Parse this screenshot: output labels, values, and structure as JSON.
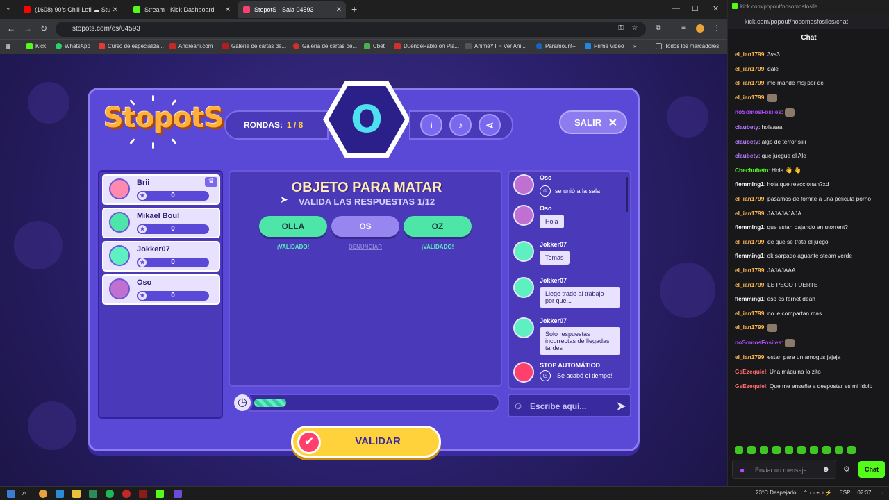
{
  "browser": {
    "tabs": [
      {
        "title": "(1608) 90's Chill Lofi ☁ Stu",
        "icon_color": "#ff0000"
      },
      {
        "title": "Stream - Kick Dashboard",
        "icon_color": "#53fc18"
      },
      {
        "title": "StopotS - Sala 04593",
        "icon_color": "#ff3f6c",
        "active": true
      }
    ],
    "url": "stopots.com/es/04593",
    "bookmarks": [
      {
        "label": "Kick",
        "color": "#53fc18"
      },
      {
        "label": "WhatsApp",
        "color": "#25d366"
      },
      {
        "label": "Curso de especializa...",
        "color": "#e53935"
      },
      {
        "label": "Andreani.com",
        "color": "#c62828"
      },
      {
        "label": "Galería de cartas de...",
        "color": "#b71c1c"
      },
      {
        "label": "Galería de cartas de...",
        "color": "#d32f2f"
      },
      {
        "label": "Cbet",
        "color": "#4caf50"
      },
      {
        "label": "DuendePablo on Pla...",
        "color": "#d32f2f"
      },
      {
        "label": "AnimeYT ~ Ver Ani...",
        "color": "#555555"
      },
      {
        "label": "Paramount+",
        "color": "#1565c0"
      },
      {
        "label": "Prime Video",
        "color": "#1e88e5"
      },
      {
        "label": "Todos los marcadores",
        "color": "#888888"
      }
    ]
  },
  "game": {
    "logo": "StopotS",
    "rounds_label": "RONDAS:",
    "rounds_value": "1 / 8",
    "letter": "O",
    "exit_label": "SALIR",
    "category": "OBJETO PARA MATAR",
    "validate_info": "VALIDA LAS RESPUESTAS 1/12",
    "answers": [
      {
        "text": "OLLA",
        "status": "¡VALIDADO!",
        "state": "ok"
      },
      {
        "text": "OS",
        "status": "DENUNCIAR",
        "state": "pending"
      },
      {
        "text": "OZ",
        "status": "¡VALIDADO!",
        "state": "ok"
      }
    ],
    "timer_progress": 0.12,
    "validate_button": "VALIDAR",
    "players": [
      {
        "name": "Brii",
        "score": "0",
        "avatar_color": "#ff8ab0",
        "host": true
      },
      {
        "name": "Mikael Boul",
        "score": "0",
        "avatar_color": "#4ee6a8",
        "host": false
      },
      {
        "name": "Jokker07",
        "score": "0",
        "avatar_color": "#5ef0c0",
        "host": false
      },
      {
        "name": "Oso",
        "score": "0",
        "avatar_color": "#c070d0",
        "host": false
      }
    ],
    "chat": [
      {
        "name": "Oso",
        "text": "se unió a la sala",
        "system": true
      },
      {
        "name": "Oso",
        "text": "Hola"
      },
      {
        "name": "Jokker07",
        "text": "Temas"
      },
      {
        "name": "Jokker07",
        "text": "Llege trade al trabajo por que..."
      },
      {
        "name": "Jokker07",
        "text": "Solo respuestas incorrectas de llegadas tardes"
      },
      {
        "name": "STOP AUTOMÁTICO",
        "text": "¡Se acabó el tiempo!",
        "system": true
      }
    ],
    "chat_placeholder": "Escribe aquí..."
  },
  "kick": {
    "window_title": "kick.com/popout/nosomosfosile...",
    "url": "kick.com/popout/nosomosfosiles/chat",
    "header": "Chat",
    "messages": [
      {
        "user": "el_ian1799",
        "color": "#ffb84d",
        "text": "3vs3"
      },
      {
        "user": "el_ian1799",
        "color": "#ffb84d",
        "text": "dale"
      },
      {
        "user": "el_ian1799",
        "color": "#ffb84d",
        "text": "me mande msj por dc"
      },
      {
        "user": "el_ian1799",
        "color": "#ffb84d",
        "text": "",
        "emote": true
      },
      {
        "user": "noSomosFosiles",
        "color": "#b04cff",
        "text": "",
        "emote": true
      },
      {
        "user": "claubety",
        "color": "#b87cff",
        "text": "holaaaa"
      },
      {
        "user": "claubety",
        "color": "#b87cff",
        "text": "algo de terror siiii"
      },
      {
        "user": "claubety",
        "color": "#b87cff",
        "text": "que juegue el Ale"
      },
      {
        "user": "Chechubeto",
        "color": "#53fc18",
        "text": "Hola 👋 👋"
      },
      {
        "user": "flemming1",
        "color": "#ffffff",
        "text": "hola que reaccionan?xd"
      },
      {
        "user": "el_ian1799",
        "color": "#ffb84d",
        "text": "pasamos de fornite a una pelicula porno"
      },
      {
        "user": "el_ian1799",
        "color": "#ffb84d",
        "text": "JAJAJAJAJA"
      },
      {
        "user": "flemming1",
        "color": "#ffffff",
        "text": "que estan bajando en utorrent?"
      },
      {
        "user": "el_ian1799",
        "color": "#ffb84d",
        "text": "de que se trata el juego"
      },
      {
        "user": "flemming1",
        "color": "#ffffff",
        "text": "ok sarpado aguante steam verde"
      },
      {
        "user": "el_ian1799",
        "color": "#ffb84d",
        "text": "JAJAJAAA"
      },
      {
        "user": "el_ian1799",
        "color": "#ffb84d",
        "text": "LE PEGO FUERTE"
      },
      {
        "user": "flemming1",
        "color": "#ffffff",
        "text": "eso es fernet deah"
      },
      {
        "user": "el_ian1799",
        "color": "#ffb84d",
        "text": "no le compartan mas"
      },
      {
        "user": "el_ian1799",
        "color": "#ffb84d",
        "text": "",
        "emote": true
      },
      {
        "user": "noSomosFosiles",
        "color": "#b04cff",
        "text": "",
        "emote": true
      },
      {
        "user": "el_ian1799",
        "color": "#ffb84d",
        "text": "estan para un amogus jajaja"
      },
      {
        "user": "GsEzequiel",
        "color": "#ff6b6b",
        "text": "Una máquina lo zito"
      },
      {
        "user": "GsEzequiel",
        "color": "#ff6b6b",
        "text": "Que me enseñe a despostar es mi ídolo"
      }
    ],
    "input_placeholder": "Enviar un mensaje",
    "send_label": "Chat"
  },
  "taskbar": {
    "weather": "23°C Despejado",
    "lang": "ESP",
    "time": "02:37"
  }
}
